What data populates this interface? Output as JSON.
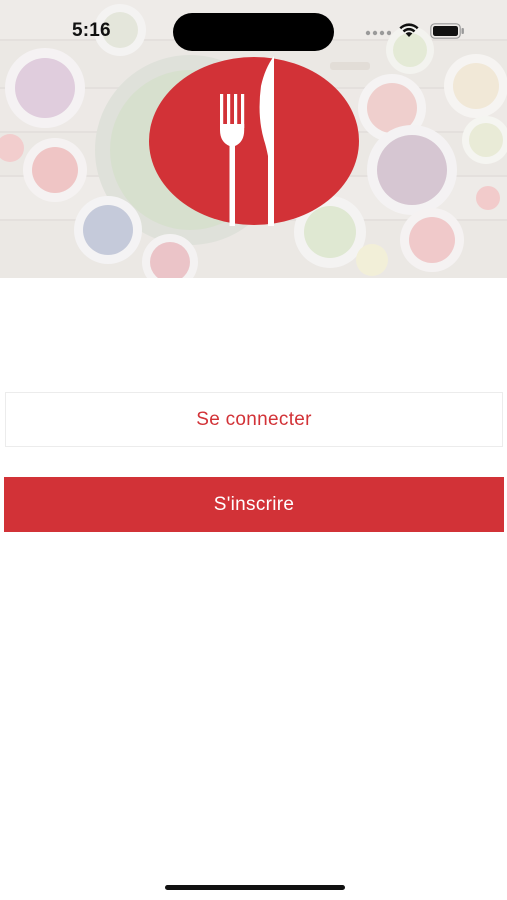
{
  "status_bar": {
    "time": "5:16",
    "signal_icon": "cellular-signal-icon",
    "wifi_icon": "wifi-icon",
    "battery_icon": "battery-icon"
  },
  "hero": {
    "background": "food-table-photo",
    "logo_icon": "fork-knife-logo-icon"
  },
  "auth": {
    "login_label": "Se connecter",
    "signup_label": "S'inscrire"
  },
  "colors": {
    "brand_red": "#d23237",
    "background": "#ffffff"
  }
}
